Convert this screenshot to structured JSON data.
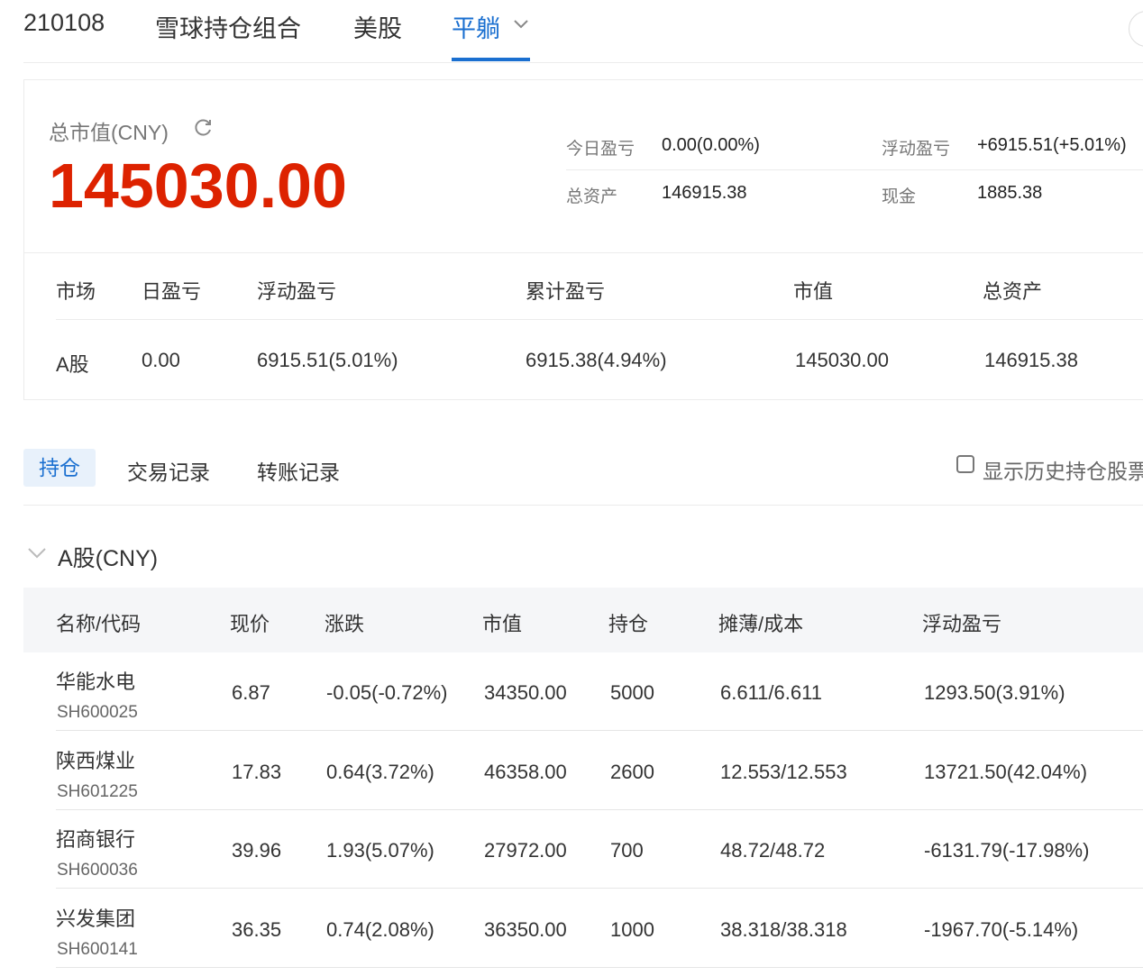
{
  "nav": {
    "items": [
      "210108",
      "雪球持仓组合",
      "美股",
      "平躺"
    ],
    "active": 3
  },
  "summary": {
    "title": "总市值(CNY)",
    "total": "145030.00",
    "today_label": "今日盈亏",
    "today_value": "0.00(0.00%)",
    "float_label": "浮动盈亏",
    "float_value": "+6915.51(+5.01%)",
    "assets_label": "总资产",
    "assets_value": "146915.38",
    "cash_label": "现金",
    "cash_value": "1885.38"
  },
  "market_table": {
    "headers": [
      "市场",
      "日盈亏",
      "浮动盈亏",
      "累计盈亏",
      "市值",
      "总资产"
    ],
    "rows": [
      [
        "A股",
        "0.00",
        "6915.51(5.01%)",
        "6915.38(4.94%)",
        "145030.00",
        "146915.38"
      ]
    ]
  },
  "tabs": {
    "items": [
      "持仓",
      "交易记录",
      "转账记录"
    ],
    "active": 0,
    "history_checkbox": "显示历史持仓股票",
    "history_checked": false
  },
  "section": {
    "title": "A股(CNY)"
  },
  "holdings": {
    "headers": [
      "名称/代码",
      "现价",
      "涨跌",
      "市值",
      "持仓",
      "摊薄/成本",
      "浮动盈亏"
    ],
    "rows": [
      {
        "name": "华能水电",
        "code": "SH600025",
        "price": "6.87",
        "change": "-0.05(-0.72%)",
        "value": "34350.00",
        "qty": "5000",
        "cost": "6.611/6.611",
        "pnl": "1293.50(3.91%)",
        "change_dir": "down",
        "pnl_dir": "up"
      },
      {
        "name": "陕西煤业",
        "code": "SH601225",
        "price": "17.83",
        "change": "0.64(3.72%)",
        "value": "46358.00",
        "qty": "2600",
        "cost": "12.553/12.553",
        "pnl": "13721.50(42.04%)",
        "change_dir": "up",
        "pnl_dir": "up"
      },
      {
        "name": "招商银行",
        "code": "SH600036",
        "price": "39.96",
        "change": "1.93(5.07%)",
        "value": "27972.00",
        "qty": "700",
        "cost": "48.72/48.72",
        "pnl": "-6131.79(-17.98%)",
        "change_dir": "up",
        "pnl_dir": "down"
      },
      {
        "name": "兴发集团",
        "code": "SH600141",
        "price": "36.35",
        "change": "0.74(2.08%)",
        "value": "36350.00",
        "qty": "1000",
        "cost": "38.318/38.318",
        "pnl": "-1967.70(-5.14%)",
        "change_dir": "up",
        "pnl_dir": "down"
      }
    ]
  },
  "colors": {
    "up": "#e0260f",
    "down": "#0a9a3a",
    "accent": "#1a6fd0"
  }
}
